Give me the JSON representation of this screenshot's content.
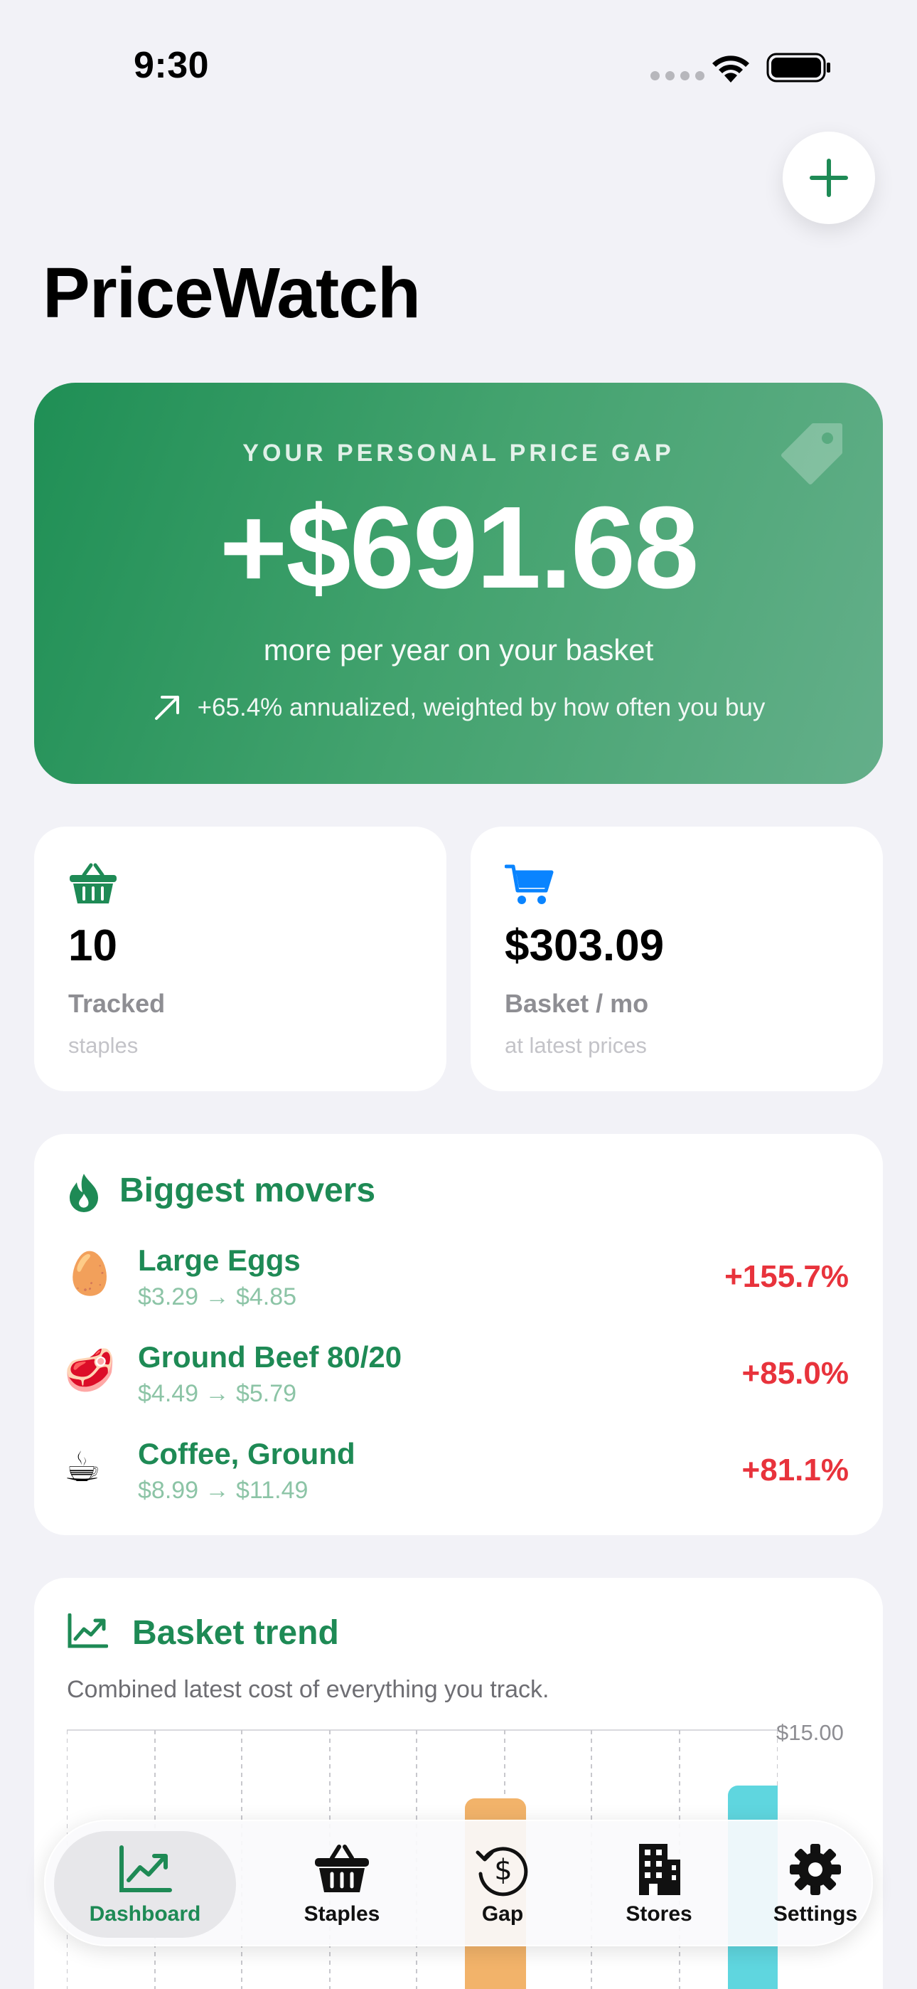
{
  "status_bar": {
    "time": "9:30"
  },
  "header": {
    "title": "PriceWatch",
    "add_icon": "plus-icon"
  },
  "gap_card": {
    "label": "YOUR PERSONAL PRICE GAP",
    "amount": "+$691.68",
    "subtitle": "more per year on your basket",
    "note": "+65.4% annualized, weighted by how often you buy",
    "colors": {
      "start": "#1F8F55",
      "end": "#64AF8A"
    }
  },
  "stats": [
    {
      "icon": "basket-icon",
      "value": "10",
      "label": "Tracked",
      "sub": "staples",
      "color": "#1E8A55"
    },
    {
      "icon": "cart-icon",
      "value": "$303.09",
      "label": "Basket / mo",
      "sub": "at latest prices",
      "color": "#0A84FF"
    }
  ],
  "movers": {
    "title": "Biggest movers",
    "items": [
      {
        "emoji": "🥚",
        "name": "Large Eggs",
        "prices": "$3.29 → $4.85",
        "pct": "+155.7%"
      },
      {
        "emoji": "🥩",
        "name": "Ground Beef 80/20",
        "prices": "$4.49 → $5.79",
        "pct": "+85.0%"
      },
      {
        "emoji": "☕",
        "name": "Coffee, Ground",
        "prices": "$8.99 → $11.49",
        "pct": "+81.1%"
      }
    ]
  },
  "trend": {
    "title": "Basket trend",
    "description": "Combined latest cost of everything you track.",
    "y_top_label": "$15.00"
  },
  "tabbar": {
    "active": "Dashboard",
    "tabs": [
      {
        "label": "Dashboard",
        "icon": "chart-line-icon"
      },
      {
        "label": "Staples",
        "icon": "basket-icon"
      },
      {
        "label": "Gap",
        "icon": "dollar-history-icon"
      },
      {
        "label": "Stores",
        "icon": "building-icon"
      },
      {
        "label": "Settings",
        "icon": "gear-icon"
      }
    ]
  },
  "colors": {
    "accent": "#1E8A55",
    "negative": "#E8333C",
    "background": "#F2F2F7"
  }
}
